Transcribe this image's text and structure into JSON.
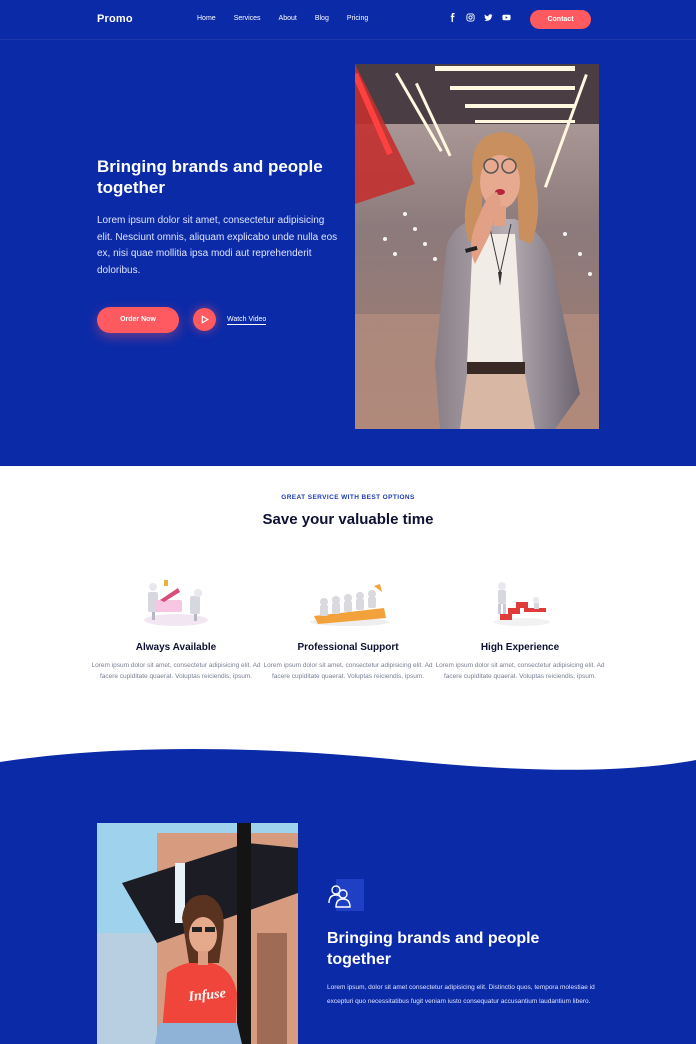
{
  "brand": "Promo",
  "nav": {
    "items": [
      "Home",
      "Services",
      "About",
      "Blog",
      "Pricing"
    ],
    "socials": [
      "facebook-icon",
      "instagram-icon",
      "twitter-icon",
      "youtube-icon"
    ],
    "contact_label": "Contact"
  },
  "hero": {
    "title": "Bringing brands and people together",
    "description": "Lorem ipsum dolor sit amet, consectetur adipisicing elit. Nesciunt omnis, aliquam explicabo unde nulla eos ex, nisi quae mollitia ipsa modi aut reprehenderit doloribus.",
    "order_label": "Order Now",
    "watch_label": "Watch Video"
  },
  "services": {
    "eyebrow": "GREAT SERVICE WITH BEST OPTIONS",
    "title": "Save your valuable time",
    "cards": [
      {
        "title": "Always Available",
        "text": "Lorem ipsum dolor sit amet, consectetur adipisicing elit. Ad facere cupiditate quaerat. Voluptas reiciendis, ipsum."
      },
      {
        "title": "Professional Support",
        "text": "Lorem ipsum dolor sit amet, consectetur adipisicing elit. Ad facere cupiditate quaerat. Voluptas reiciendis, ipsum."
      },
      {
        "title": "High Experience",
        "text": "Lorem ipsum dolor sit amet, consectetur adipisicing elit. Ad facere cupiditate quaerat. Voluptas reiciendis, ipsum."
      }
    ]
  },
  "about": {
    "title": "Bringing brands and people together",
    "description": "Lorem ipsum, dolor sit amet consectetur adipisicing elit. Distinctio quos, tempora molestiae id excepturi quo necessitatibus fugit veniam iusto consequatur accusantium laudantium libero.",
    "shirt_text": "Infuse"
  },
  "colors": {
    "primary": "#0b2aa8",
    "accent": "#ff5a5f",
    "heading": "#0e1133"
  }
}
